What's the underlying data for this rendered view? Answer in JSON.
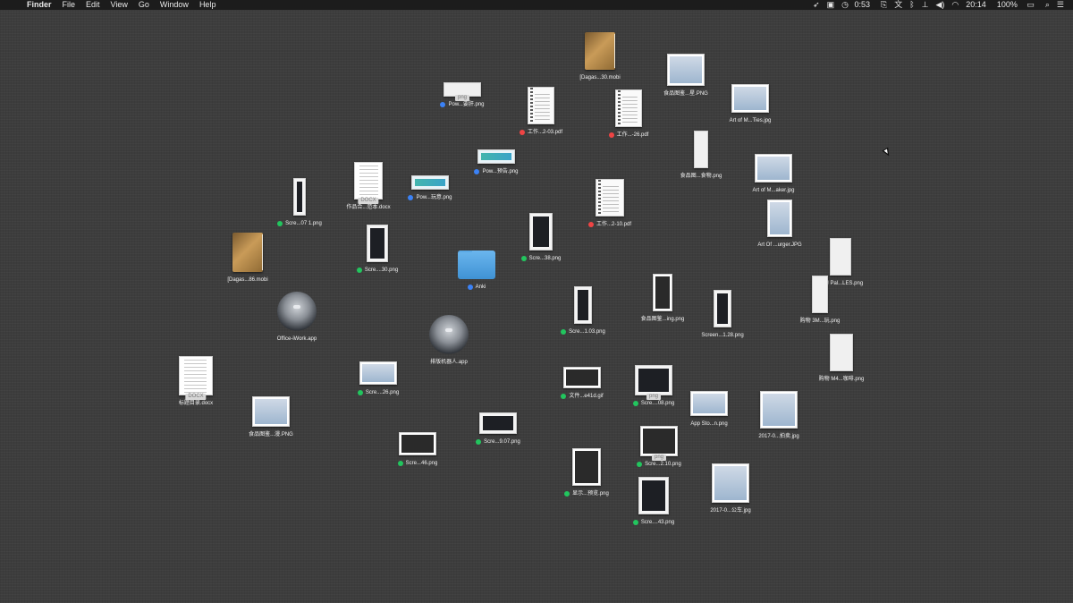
{
  "menubar": {
    "apple": "",
    "items": [
      "Finder",
      "File",
      "Edit",
      "View",
      "Go",
      "Window",
      "Help"
    ],
    "status": {
      "timer": "0:53",
      "clock": "20:14",
      "battery": "100%"
    }
  },
  "icons": [
    {
      "label": "[Dagas...30.mobi",
      "kind": "book",
      "tag": ""
    },
    {
      "label": "食品图鉴...星.PNG",
      "kind": "picture",
      "tag": ""
    },
    {
      "label": "Pow...要肝.png",
      "kind": "small",
      "tag": "#3b82f6",
      "ext": "png"
    },
    {
      "label": "工作...2-03.pdf",
      "kind": "pdf",
      "tag": "#ef4444"
    },
    {
      "label": "工作...-26.pdf",
      "kind": "pdf",
      "tag": "#ef4444"
    },
    {
      "label": "Art of M...Ties.jpg",
      "kind": "picture",
      "tag": ""
    },
    {
      "label": "食品图...食物.png",
      "kind": "small",
      "tag": ""
    },
    {
      "label": "Pow...预告.png",
      "kind": "banner",
      "tag": "#3b82f6"
    },
    {
      "label": "Art of M...aker.jpg",
      "kind": "picture",
      "tag": ""
    },
    {
      "label": "作品合...范本.docx",
      "kind": "doc",
      "tag": "",
      "ext": "DOCX"
    },
    {
      "label": "Pow...玩意.png",
      "kind": "banner",
      "tag": "#3b82f6"
    },
    {
      "label": "Scre...07 1.png",
      "kind": "screen",
      "tag": "#22c55e"
    },
    {
      "label": "工作...2-10.pdf",
      "kind": "pdf",
      "tag": "#ef4444"
    },
    {
      "label": "Art Of ...urger.JPG",
      "kind": "picture",
      "tag": ""
    },
    {
      "label": "Scre...38.png",
      "kind": "screen",
      "tag": "#22c55e"
    },
    {
      "label": "[Dagas...86.mobi",
      "kind": "book",
      "tag": ""
    },
    {
      "label": "Scre....30.png",
      "kind": "screen",
      "tag": "#22c55e"
    },
    {
      "label": "Anki",
      "kind": "folder",
      "tag": "#3b82f6"
    },
    {
      "label": "购物 Pal...LES.png",
      "kind": "small",
      "tag": ""
    },
    {
      "label": "Scre...1.03.png",
      "kind": "screen",
      "tag": "#22c55e"
    },
    {
      "label": "食品图鉴...ing.png",
      "kind": "dark",
      "tag": ""
    },
    {
      "label": "Screen...1.28.png",
      "kind": "screen",
      "tag": ""
    },
    {
      "label": "购物 3M...玩.png",
      "kind": "small",
      "tag": ""
    },
    {
      "label": "Office-iWork.app",
      "kind": "app",
      "tag": ""
    },
    {
      "label": "排版机器人.app",
      "kind": "app",
      "tag": ""
    },
    {
      "label": "购物 M4...咖啡.png",
      "kind": "small",
      "tag": ""
    },
    {
      "label": "标题目录.docx",
      "kind": "doc",
      "tag": "",
      "ext": "DOCX"
    },
    {
      "label": "Scre....26.png",
      "kind": "picture",
      "tag": "#22c55e"
    },
    {
      "label": "文件...e41d.gif",
      "kind": "dark",
      "tag": "#22c55e"
    },
    {
      "label": "Scre....08.png",
      "kind": "screen",
      "tag": "#22c55e",
      "ext": "png"
    },
    {
      "label": "App Sto...n.png",
      "kind": "picture",
      "tag": ""
    },
    {
      "label": "2017-0...拍卖.jpg",
      "kind": "picture",
      "tag": ""
    },
    {
      "label": "食品图鉴...漫.PNG",
      "kind": "picture",
      "tag": ""
    },
    {
      "label": "Scre...46.png",
      "kind": "dark",
      "tag": "#22c55e"
    },
    {
      "label": "Scre...9.07.png",
      "kind": "screen",
      "tag": "#22c55e"
    },
    {
      "label": "Scre...2.10.png",
      "kind": "dark",
      "tag": "#22c55e",
      "ext": "png"
    },
    {
      "label": "显示...预览.png",
      "kind": "dark",
      "tag": "#22c55e"
    },
    {
      "label": "2017-0...公车.jpg",
      "kind": "picture",
      "tag": ""
    },
    {
      "label": "Scre....43.png",
      "kind": "screen",
      "tag": "#22c55e"
    }
  ]
}
